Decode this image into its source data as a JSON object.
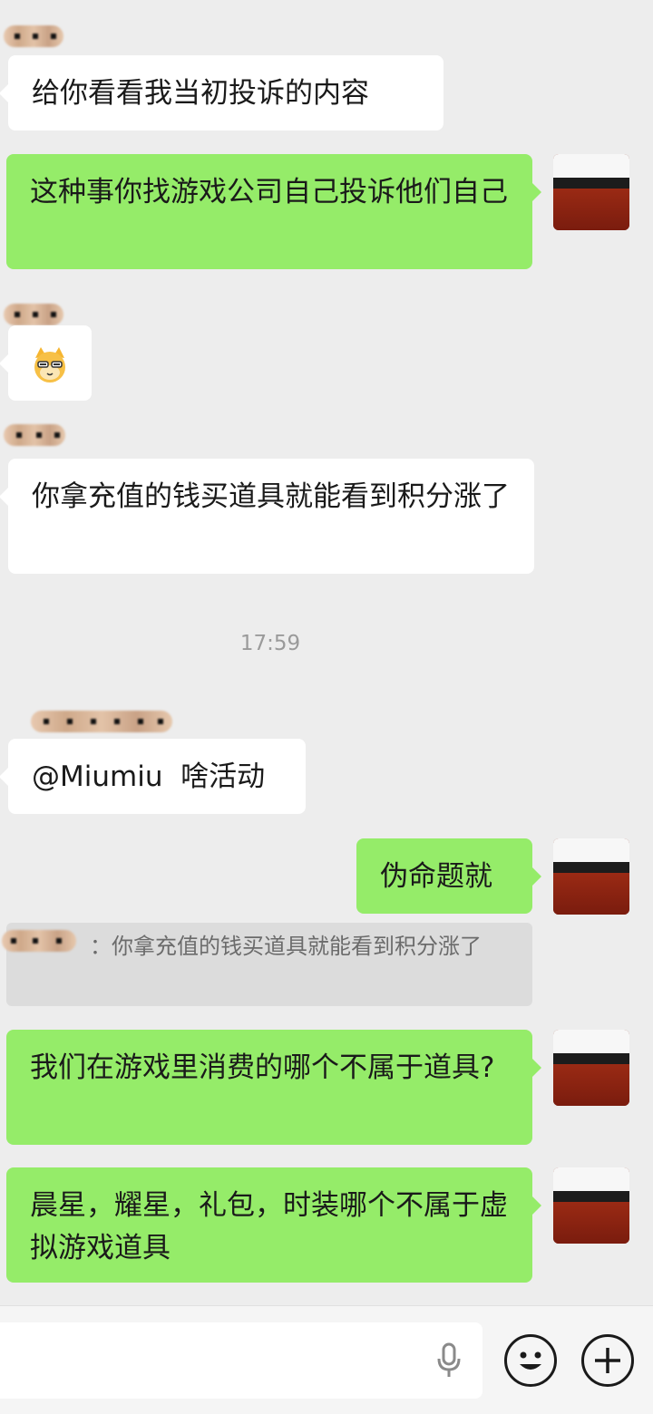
{
  "messages": [
    {
      "id": "m1",
      "side": "in",
      "text": "给你看看我当初投诉的内容"
    },
    {
      "id": "m2",
      "side": "out",
      "text": "这种事你找游戏公司自己投诉他们自己"
    },
    {
      "id": "m3",
      "side": "in",
      "sticker": "cat-emoji"
    },
    {
      "id": "m4",
      "side": "in",
      "text": "你拿充值的钱买道具就能看到积分涨了"
    },
    {
      "id": "m5",
      "side": "in",
      "text": "@Miumiu  啥活动"
    },
    {
      "id": "m6",
      "side": "out",
      "text": "伪命题就"
    },
    {
      "id": "m7",
      "side": "out",
      "text": "我们在游戏里消费的哪个不属于道具?"
    },
    {
      "id": "m8",
      "side": "out",
      "text": "晨星，耀星，礼包，时装哪个不属于虚拟游戏道具"
    }
  ],
  "timestamp": "17:59",
  "quote": {
    "text": "：你拿充值的钱买道具就能看到积分涨了"
  },
  "input_bar": {
    "voice_icon": "microphone-icon",
    "emoji_icon": "smiley-icon",
    "more_icon": "plus-icon"
  },
  "colors": {
    "background": "#ededed",
    "incoming_bubble": "#ffffff",
    "outgoing_bubble": "#95ec69"
  }
}
